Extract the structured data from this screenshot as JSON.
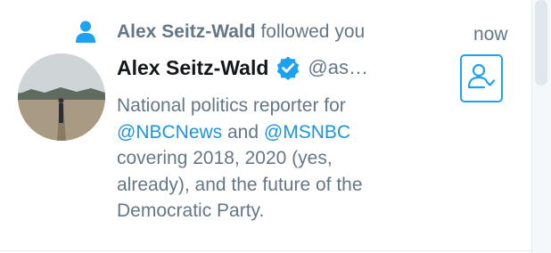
{
  "notification": {
    "icon": "person-icon",
    "actor": "Alex Seitz-Wald",
    "action": "followed you",
    "time": "now"
  },
  "user": {
    "name": "Alex Seitz-Wald",
    "verified_icon": "verified-badge-icon",
    "handle": "@as…",
    "bio": {
      "line1": "National politics reporter for",
      "mention1": "@NBCNews",
      "and": " and ",
      "mention2": "@MSNBC",
      "line3": "covering 2018, 2020 (yes,",
      "line4": "already), and the future of the",
      "line5": "Democratic Party."
    }
  },
  "follow_button": {
    "icon": "follow-user-icon"
  },
  "colors": {
    "accent": "#1da1f2",
    "link": "#1b95e0",
    "secondary_text": "#657786",
    "primary_text": "#14171a"
  }
}
